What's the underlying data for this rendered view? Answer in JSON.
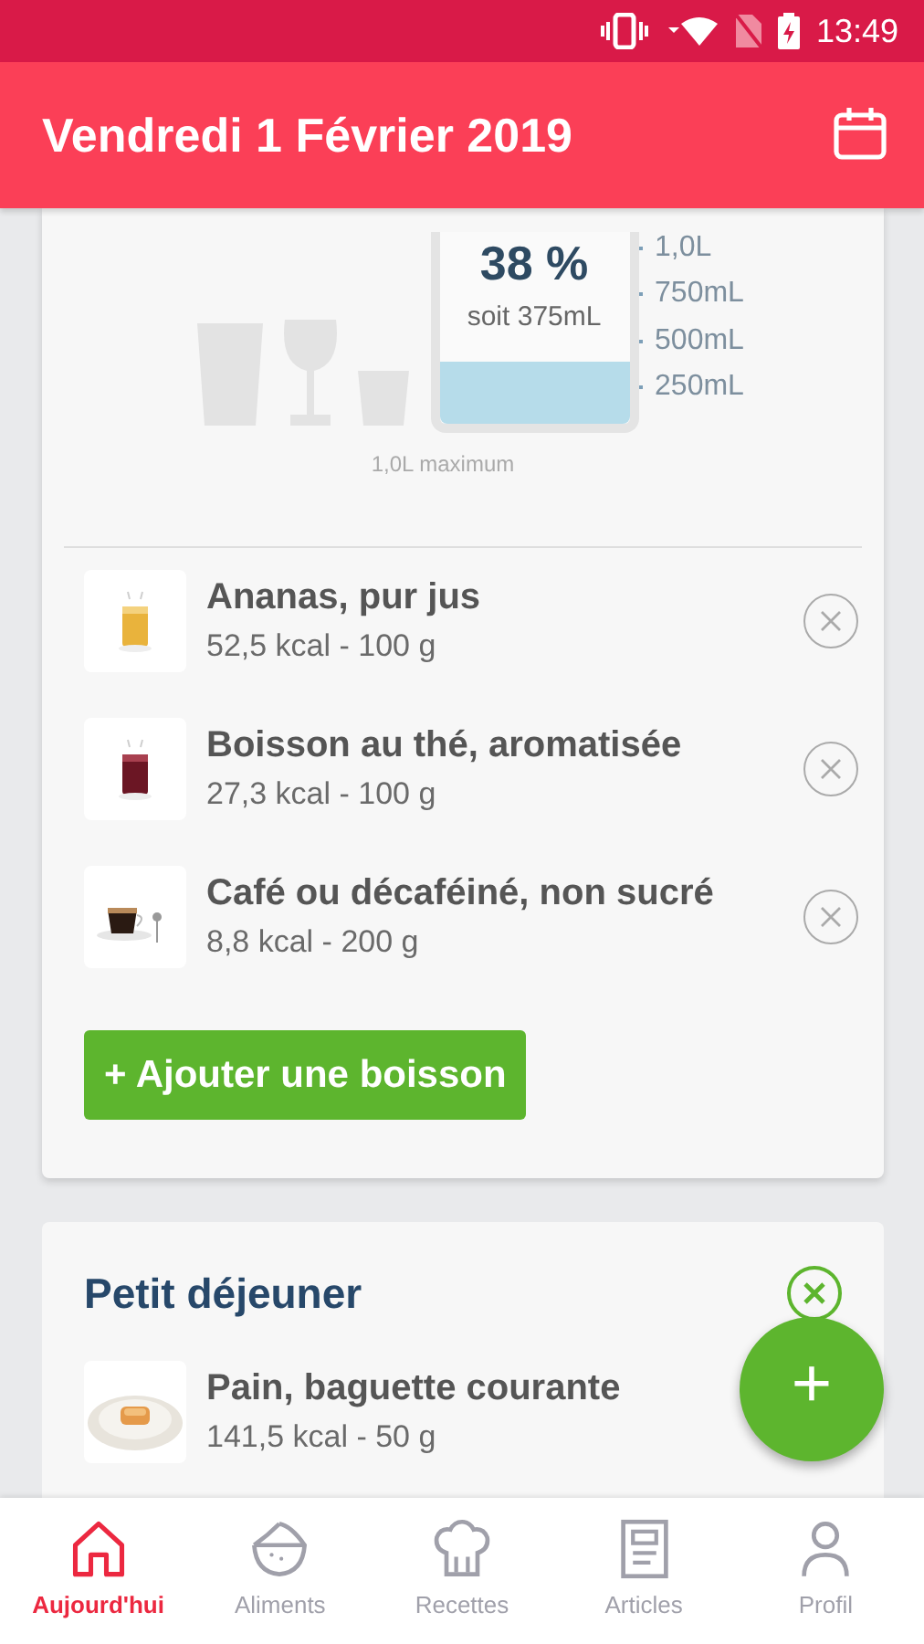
{
  "status_bar": {
    "time": "13:49"
  },
  "header": {
    "title": "Vendredi 1 Février 2019"
  },
  "hydration": {
    "percent": "38 %",
    "amount": "soit 375mL",
    "scale": [
      "1,0L",
      "750mL",
      "500mL",
      "250mL"
    ],
    "maximum": "1,0L maximum",
    "drinks": [
      {
        "name": "Ananas, pur jus",
        "details": "52,5 kcal - 100 g"
      },
      {
        "name": "Boisson au thé, aromatisée",
        "details": "27,3 kcal - 100 g"
      },
      {
        "name": "Café ou décaféiné, non sucré",
        "details": "8,8 kcal - 200 g"
      }
    ],
    "add_button": "+ Ajouter une boisson"
  },
  "meals": [
    {
      "title": "Petit déjeuner",
      "items": [
        {
          "name": "Pain, baguette courante",
          "details": "141,5 kcal - 50 g"
        }
      ]
    }
  ],
  "fab": {
    "label": "+"
  },
  "nav": [
    {
      "label": "Aujourd'hui",
      "selected": true,
      "kind": "home"
    },
    {
      "label": "Aliments",
      "selected": false,
      "kind": "melon"
    },
    {
      "label": "Recettes",
      "selected": false,
      "kind": "chef"
    },
    {
      "label": "Articles",
      "selected": false,
      "kind": "article"
    },
    {
      "label": "Profil",
      "selected": false,
      "kind": "person"
    }
  ]
}
